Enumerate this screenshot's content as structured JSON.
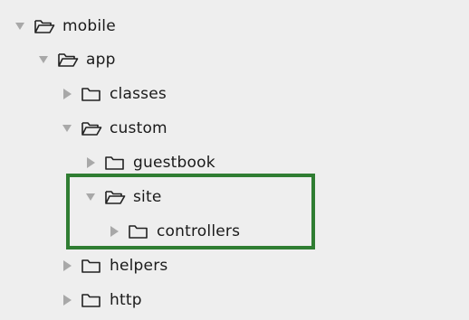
{
  "tree": {
    "items": [
      {
        "label": "mobile",
        "state": "expanded",
        "icon": "folder-open-icon"
      },
      {
        "label": "app",
        "state": "expanded",
        "icon": "folder-open-icon"
      },
      {
        "label": "classes",
        "state": "collapsed",
        "icon": "folder-closed-icon"
      },
      {
        "label": "custom",
        "state": "expanded",
        "icon": "folder-open-icon"
      },
      {
        "label": "guestbook",
        "state": "collapsed",
        "icon": "folder-closed-icon"
      },
      {
        "label": "site",
        "state": "expanded",
        "icon": "folder-open-icon"
      },
      {
        "label": "controllers",
        "state": "collapsed",
        "icon": "folder-closed-icon"
      },
      {
        "label": "helpers",
        "state": "collapsed",
        "icon": "folder-closed-icon"
      },
      {
        "label": "http",
        "state": "collapsed",
        "icon": "folder-closed-icon"
      }
    ]
  },
  "colors": {
    "background": "#eeeeee",
    "arrow": "#a8a8a8",
    "folder_stroke": "#222222",
    "highlight_border": "#2f7d32",
    "text": "#1a1a1a"
  }
}
